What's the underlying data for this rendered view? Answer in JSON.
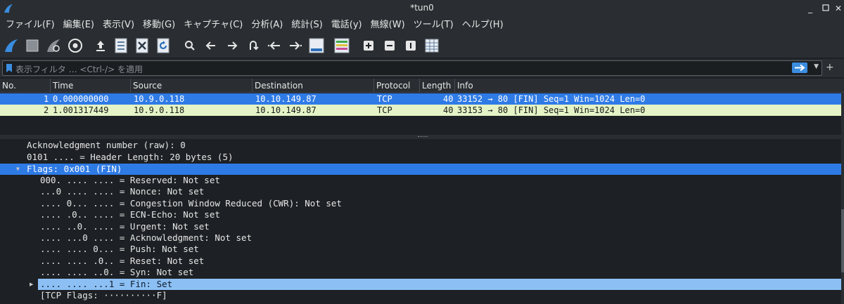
{
  "window": {
    "title": "*tun0"
  },
  "menu": [
    "ファイル(F)",
    "編集(E)",
    "表示(V)",
    "移動(G)",
    "キャプチャ(C)",
    "分析(A)",
    "統計(S)",
    "電話(y)",
    "無線(W)",
    "ツール(T)",
    "ヘルプ(H)"
  ],
  "filter": {
    "placeholder": "表示フィルタ … <Ctrl-/> を適用"
  },
  "packet_list": {
    "columns": [
      "No.",
      "Time",
      "Source",
      "Destination",
      "Protocol",
      "Length",
      "Info"
    ],
    "rows": [
      {
        "no": "1",
        "time": "0.000000000",
        "source": "10.9.0.118",
        "destination": "10.10.149.87",
        "protocol": "TCP",
        "length": "40",
        "info": "33152 → 80 [FIN] Seq=1 Win=1024 Len=0"
      },
      {
        "no": "2",
        "time": "1.001317449",
        "source": "10.9.0.118",
        "destination": "10.10.149.87",
        "protocol": "TCP",
        "length": "40",
        "info": "33153 → 80 [FIN] Seq=1 Win=1024 Len=0"
      }
    ]
  },
  "details": [
    "Acknowledgment number (raw): 0",
    "0101 .... = Header Length: 20 bytes (5)",
    "Flags: 0x001 (FIN)",
    "000. .... .... = Reserved: Not set",
    "...0 .... .... = Nonce: Not set",
    ".... 0... .... = Congestion Window Reduced (CWR): Not set",
    ".... .0.. .... = ECN-Echo: Not set",
    ".... ..0. .... = Urgent: Not set",
    ".... ...0 .... = Acknowledgment: Not set",
    ".... .... 0... = Push: Not set",
    ".... .... .0.. = Reset: Not set",
    ".... .... ..0. = Syn: Not set",
    ".... .... ...1 = Fin: Set",
    "[TCP Flags: ··········F]"
  ],
  "colors": {
    "selected": "#2f7be6",
    "alt_row": "#e4f4c6",
    "subselected": "#8cc0f5",
    "background": "#1d2024"
  }
}
